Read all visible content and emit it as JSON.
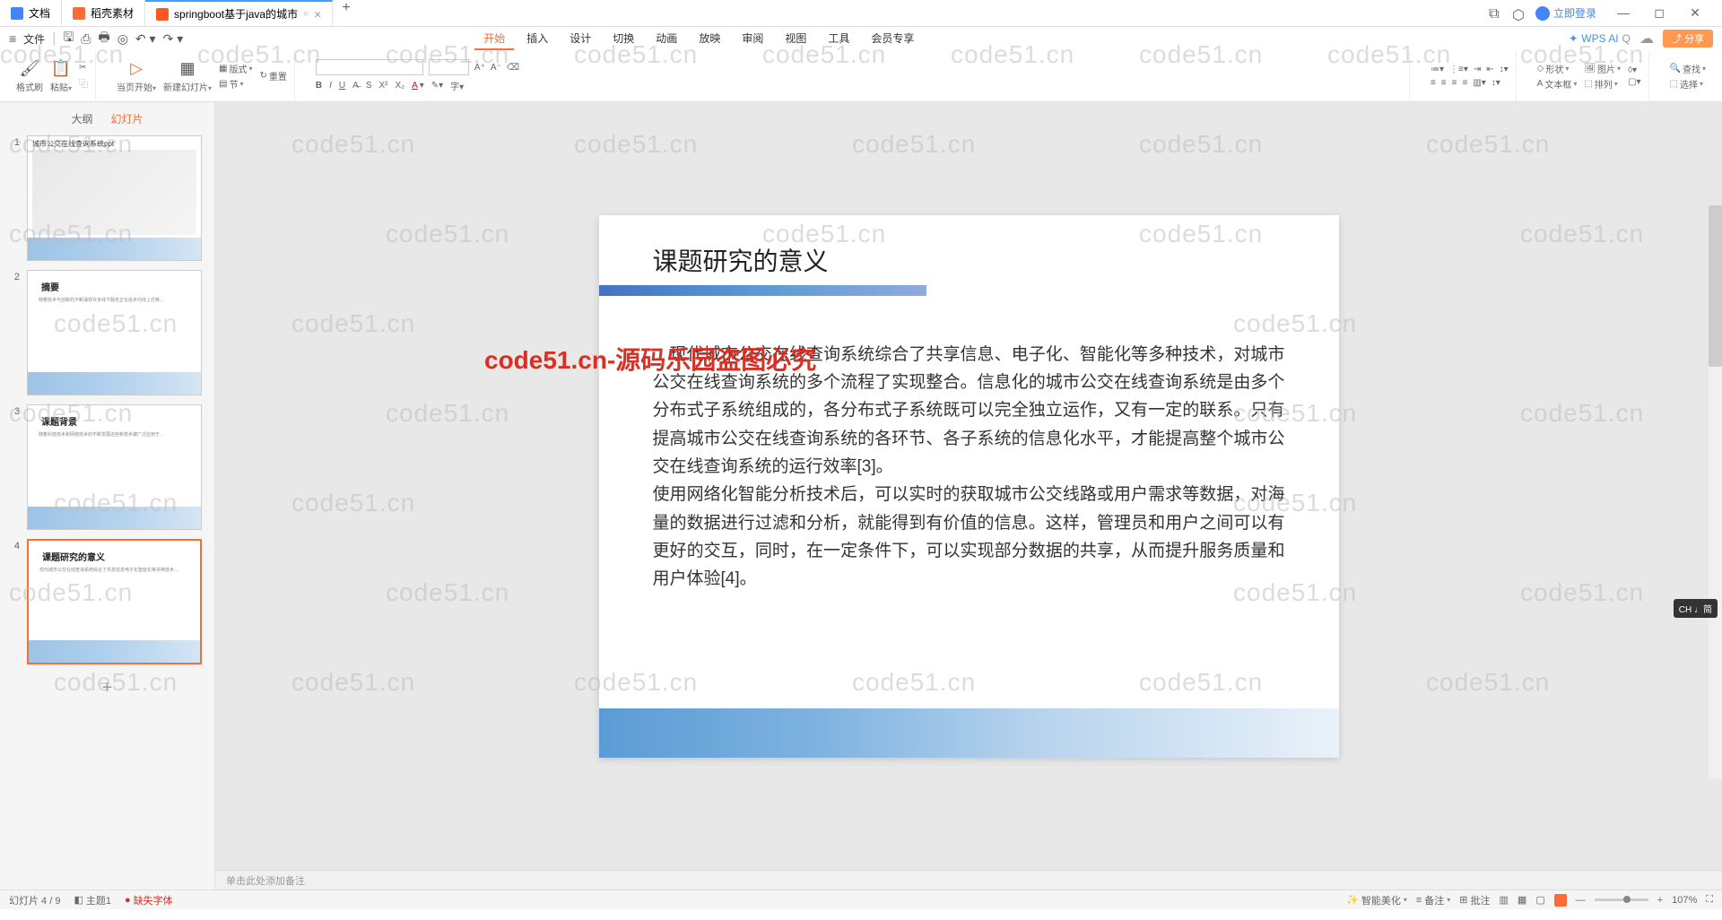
{
  "tabs": [
    {
      "label": "文档"
    },
    {
      "label": "稻壳素材"
    },
    {
      "label": "springboot基于java的城市"
    }
  ],
  "titlebar": {
    "login": "立即登录"
  },
  "menubar": {
    "file": "文件",
    "tabs": [
      "开始",
      "插入",
      "设计",
      "切换",
      "动画",
      "放映",
      "审阅",
      "视图",
      "工具",
      "会员专享"
    ],
    "wps_ai": "WPS AI"
  },
  "toolbar": {
    "format_painter": "格式刷",
    "paste": "粘贴",
    "current_page": "当页开始",
    "new_slide": "新建幻灯片",
    "layout": "版式",
    "reset": "重置",
    "section": "节",
    "shape": "形状",
    "picture": "图片",
    "textbox": "文本框",
    "arrange": "排列",
    "find": "查找",
    "select": "选择"
  },
  "sidebar": {
    "outline": "大纲",
    "slides": "幻灯片",
    "slide1_title": "城市公交在线查询系统ppt",
    "slide2_title": "摘要",
    "slide3_title": "课题背景",
    "slide4_title": "课题研究的意义"
  },
  "slide": {
    "title": "课题研究的意义",
    "para1": "　现代城市公交在线查询系统综合了共享信息、电子化、智能化等多种技术，对城市公交在线查询系统的多个流程了实现整合。信息化的城市公交在线查询系统是由多个分布式子系统组成的，各分布式子系统既可以完全独立运作，又有一定的联系。只有提高城市公交在线查询系统的各环节、各子系统的信息化水平，才能提高整个城市公交在线查询系统的运行效率[3]。",
    "para2": "使用网络化智能分析技术后，可以实时的获取城市公交线路或用户需求等数据，对海量的数据进行过滤和分析，就能得到有价值的信息。这样，管理员和用户之间可以有更好的交互，同时，在一定条件下，可以实现部分数据的共享，从而提升服务质量和用户体验[4]。"
  },
  "notes": "单击此处添加备注",
  "watermark": "code51.cn",
  "watermark_red": "code51.cn-源码乐园盗图必究",
  "statusbar": {
    "slide_count": "幻灯片 4 / 9",
    "theme": "主题1",
    "missing_font": "缺失字体",
    "smart_beautify": "智能美化",
    "notes": "备注",
    "comments": "批注",
    "zoom": "107%"
  },
  "ime": "CH ♩简"
}
